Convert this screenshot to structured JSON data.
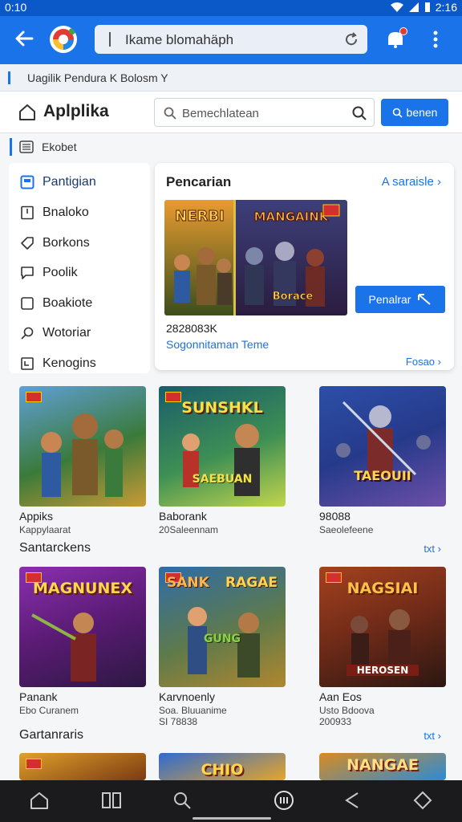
{
  "status": {
    "time": "0:10",
    "clock": "2:16"
  },
  "browser": {
    "address": "Ikame blomahäph"
  },
  "breadcrumb": {
    "text": "Uagilik Pendura K Bolosm Y"
  },
  "header": {
    "title": "Aplplika",
    "search_placeholder": "Bemechlatean",
    "search_button": "benen"
  },
  "section": {
    "label": "Ekobet"
  },
  "sidebar": {
    "items": [
      {
        "label": "Pantigian",
        "icon": "grid-icon"
      },
      {
        "label": "Bnaloko",
        "icon": "book-icon"
      },
      {
        "label": "Borkons",
        "icon": "tag-icon"
      },
      {
        "label": "Poolik",
        "icon": "chat-icon"
      },
      {
        "label": "Boakiote",
        "icon": "square-icon"
      },
      {
        "label": "Wotoriar",
        "icon": "search-icon"
      },
      {
        "label": "Kenogins",
        "icon": "calendar-icon"
      }
    ]
  },
  "panel": {
    "title": "Pencarian",
    "link": "A saraisle",
    "image_text_left": "NERBI",
    "image_text_right": "MANGAINK",
    "image_text_bottom": "Borace",
    "button": "Penalrar",
    "number": "2828083K",
    "subtitle": "Sogonnitaman Teme",
    "more": "Fosao"
  },
  "row1": {
    "cards": [
      {
        "name": "Appiks",
        "sub": "Kappylaarat",
        "art": "",
        "colors": [
          "#3b7a3a",
          "#c99a35"
        ]
      },
      {
        "name": "Baborank",
        "sub": "20Saleennam",
        "art": "SUNSHKL",
        "art2": "SAEBUAN",
        "colors": [
          "#1a5d6b",
          "#c2d54d"
        ]
      },
      {
        "name": "98088",
        "sub": "Saeolefeene",
        "art": "TAEOUII",
        "colors": [
          "#263a8a",
          "#6d4fa8"
        ]
      }
    ]
  },
  "row2": {
    "heading": "Santarckens",
    "link": "txt",
    "cards": [
      {
        "name": "Panank",
        "sub": "Ebo Curanem",
        "art": "MAGNUNEX",
        "colors": [
          "#5a1b74",
          "#2c1842"
        ]
      },
      {
        "name": "Karvnoenly",
        "sub": "Soa. Bluuanime",
        "sub2": "SI 78838",
        "art": "SANK",
        "art2": "RAGAE",
        "art3": "GUNG",
        "colors": [
          "#2e6ca8",
          "#b0872f"
        ]
      },
      {
        "name": "Aan Eos",
        "sub": "Usto Bdoova",
        "sub2": "200933",
        "art": "NAGSIAI",
        "art3": "HEROSEN",
        "colors": [
          "#6e2a18",
          "#2b1712"
        ]
      }
    ]
  },
  "row3": {
    "heading": "Gartanraris",
    "link": "txt",
    "cards": [
      {
        "art": "",
        "colors": [
          "#e0a12a",
          "#7a3a12"
        ]
      },
      {
        "art": "CHIO",
        "colors": [
          "#2f6bd0",
          "#e6a52b"
        ]
      },
      {
        "art": "NANGAE",
        "colors": [
          "#d98b20",
          "#2c8bd6"
        ]
      }
    ]
  }
}
